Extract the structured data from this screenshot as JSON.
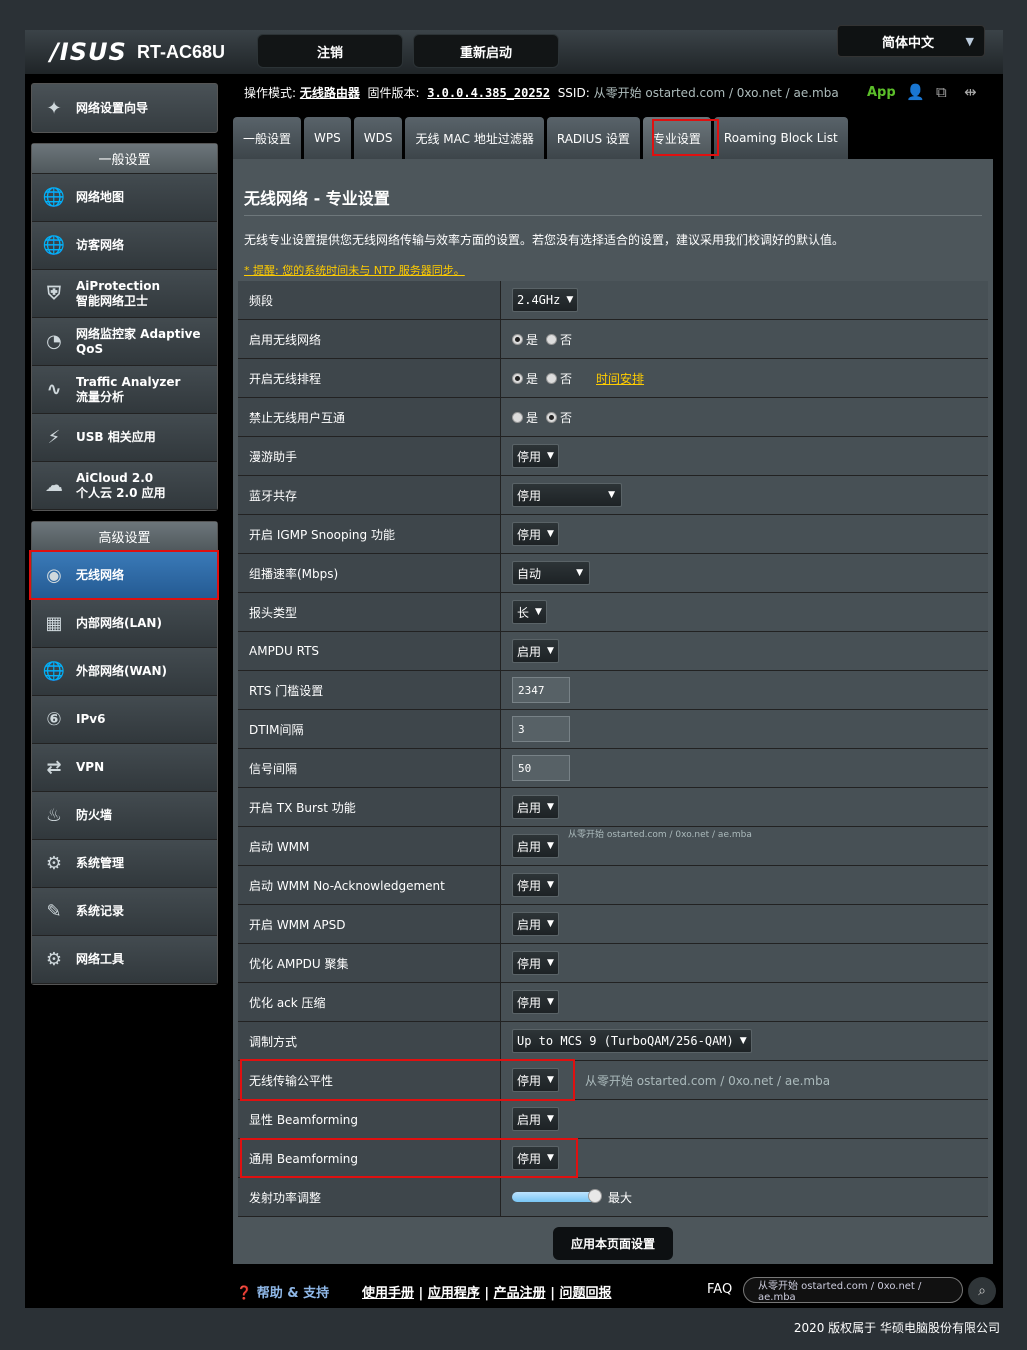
{
  "header": {
    "brand": "/ISUS",
    "model": "RT-AC68U",
    "logout": "注销",
    "reboot": "重新启动",
    "language": "简体中文"
  },
  "info": {
    "mode_label": "操作模式:",
    "mode_value": "无线路由器",
    "fw_label": "固件版本:",
    "fw_value": "3.0.0.4.385_20252",
    "ssid_label": "SSID:",
    "ssid_value": "从零开始 ostarted.com / 0xo.net / ae.mba",
    "app": "App"
  },
  "sidebar": {
    "wizard": "网络设置向导",
    "general_header": "一般设置",
    "general_items": [
      {
        "icon": "globe-icon",
        "label": "网络地图"
      },
      {
        "icon": "guest-globe-icon",
        "label": "访客网络"
      },
      {
        "icon": "shield-icon",
        "label": "AiProtection\n智能网络卫士"
      },
      {
        "icon": "gauge-icon",
        "label": "网络监控家 Adaptive\nQoS"
      },
      {
        "icon": "pulse-icon",
        "label": "Traffic Analyzer\n流量分析"
      },
      {
        "icon": "usb-icon",
        "label": "USB 相关应用"
      },
      {
        "icon": "cloud-icon",
        "label": "AiCloud 2.0\n个人云 2.0 应用"
      }
    ],
    "advanced_header": "高级设置",
    "advanced_items": [
      {
        "icon": "wifi-icon",
        "label": "无线网络"
      },
      {
        "icon": "lan-icon",
        "label": "内部网络(LAN)"
      },
      {
        "icon": "wan-globe-icon",
        "label": "外部网络(WAN)"
      },
      {
        "icon": "ipv6-icon",
        "label": "IPv6"
      },
      {
        "icon": "vpn-icon",
        "label": "VPN"
      },
      {
        "icon": "firewall-icon",
        "label": "防火墙"
      },
      {
        "icon": "admin-gear-icon",
        "label": "系统管理"
      },
      {
        "icon": "log-icon",
        "label": "系统记录"
      },
      {
        "icon": "tools-icon",
        "label": "网络工具"
      }
    ]
  },
  "tabs": [
    "一般设置",
    "WPS",
    "WDS",
    "无线 MAC 地址过滤器",
    "RADIUS 设置",
    "专业设置",
    "Roaming Block List"
  ],
  "page": {
    "title": "无线网络 - 专业设置",
    "description": "无线专业设置提供您无线网络传输与效率方面的设置。若您没有选择适合的设置，建议采用我们校调好的默认值。",
    "warning": "* 提醒: 您的系统时间未与 NTP 服务器同步。",
    "yes": "是",
    "no": "否",
    "schedule_link": "时间安排",
    "wmm_note": "从零开始 ostarted.com / 0xo.net / ae.mba",
    "fairness_note": "从零开始 ostarted.com / 0xo.net / ae.mba",
    "power_max": "最大",
    "apply": "应用本页面设置"
  },
  "rows": [
    {
      "label": "频段",
      "type": "select",
      "value": "2.4GHz"
    },
    {
      "label": "启用无线网络",
      "type": "radio",
      "value": "yes"
    },
    {
      "label": "开启无线排程",
      "type": "radio-link",
      "value": "yes"
    },
    {
      "label": "禁止无线用户互通",
      "type": "radio",
      "value": "no"
    },
    {
      "label": "漫游助手",
      "type": "select",
      "value": "停用"
    },
    {
      "label": "蓝牙共存",
      "type": "select-wide",
      "value": "停用"
    },
    {
      "label": "开启 IGMP Snooping 功能",
      "type": "select",
      "value": "停用"
    },
    {
      "label": "组播速率(Mbps)",
      "type": "select-mid",
      "value": "自动"
    },
    {
      "label": "报头类型",
      "type": "select",
      "value": "长"
    },
    {
      "label": "AMPDU RTS",
      "type": "select",
      "value": "启用"
    },
    {
      "label": "RTS 门槛设置",
      "type": "input",
      "value": "2347"
    },
    {
      "label": "DTIM间隔",
      "type": "input",
      "value": "3"
    },
    {
      "label": "信号间隔",
      "type": "input",
      "value": "50"
    },
    {
      "label": "开启 TX Burst 功能",
      "type": "select",
      "value": "启用"
    },
    {
      "label": "启动 WMM",
      "type": "select-note",
      "value": "启用"
    },
    {
      "label": "启动 WMM No-Acknowledgement",
      "type": "select",
      "value": "停用"
    },
    {
      "label": "开启 WMM APSD",
      "type": "select",
      "value": "启用"
    },
    {
      "label": "优化 AMPDU 聚集",
      "type": "select",
      "value": "停用"
    },
    {
      "label": "优化 ack 压缩",
      "type": "select",
      "value": "停用"
    },
    {
      "label": "调制方式",
      "type": "select",
      "value": "Up to MCS 9 (TurboQAM/256-QAM)"
    },
    {
      "label": "无线传输公平性",
      "type": "select-fair",
      "value": "停用"
    },
    {
      "label": "显性 Beamforming",
      "type": "select",
      "value": "启用"
    },
    {
      "label": "通用 Beamforming",
      "type": "select",
      "value": "停用"
    },
    {
      "label": "发射功率调整",
      "type": "slider",
      "value": 1.0
    }
  ],
  "footer": {
    "help": "帮助 & 支持",
    "manual": "使用手册",
    "apps": "应用程序",
    "register": "产品注册",
    "feedback": "问题回报",
    "faq": "FAQ",
    "search_text": "从零开始 ostarted.com / 0xo.net / ae.mba",
    "copyright": "2020 版权属于 华硕电脑股份有限公司"
  },
  "colors": {
    "highlight": "#e01010",
    "active_nav": "#2f6aa6",
    "warning": "#ffcc00",
    "app": "#5cbf2a"
  }
}
